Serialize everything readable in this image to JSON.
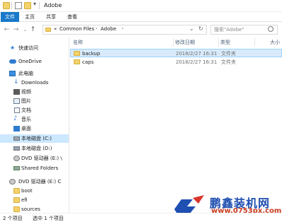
{
  "window": {
    "title": "Adobe"
  },
  "ribbon": {
    "tabs": [
      "文件",
      "主页",
      "共享",
      "查看"
    ]
  },
  "address": {
    "overflow": "«",
    "crumbs": [
      "Common Files",
      "Adobe"
    ],
    "search_placeholder": "搜索\"Adobe\""
  },
  "nav": {
    "quick_access": "快速访问",
    "onedrive": "OneDrive",
    "this_pc": "此电脑",
    "downloads": "Downloads",
    "videos": "视频",
    "pictures": "图片",
    "documents": "文档",
    "music": "音乐",
    "desktop": "桌面",
    "local_c": "本地磁盘 (C:)",
    "local_d": "本地磁盘 (D:)",
    "dvd_e": "DVD 驱动器 (E:) \\",
    "shared_folders": "Shared Folders",
    "dvd_e2": "DVD 驱动器 (E:) C",
    "boot": "boot",
    "efi": "efi",
    "sources": "sources"
  },
  "columns": {
    "name": "名称",
    "date": "修改日期",
    "type": "类型",
    "size": "大小"
  },
  "files": [
    {
      "name": "backup",
      "date": "2018/2/27 16:31",
      "type": "文件夹"
    },
    {
      "name": "caps",
      "date": "2018/2/27 16:31",
      "type": "文件夹"
    }
  ],
  "status": {
    "items": "2 个项目",
    "selected": "选中 1 个项目"
  },
  "watermark": {
    "brand": "鹏鑫装机网",
    "site": "www.0753px.com"
  },
  "colors": {
    "accent": "#1979ca",
    "selection": "#cce8ff",
    "folder": "#f3d26c"
  }
}
